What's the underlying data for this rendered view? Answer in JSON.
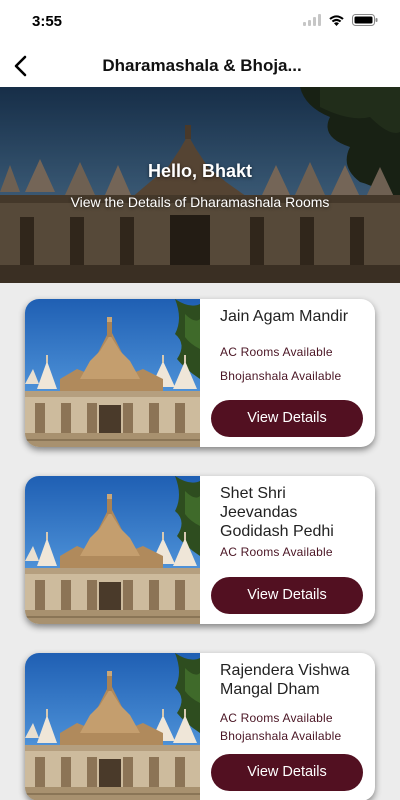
{
  "status_bar": {
    "time": "3:55"
  },
  "header": {
    "title": "Dharamashala & Bhoja...",
    "back_icon": "chevron-left-icon"
  },
  "hero": {
    "title": "Hello, Bhakt",
    "subtitle": "View the Details of Dharamashala Rooms"
  },
  "cards": [
    {
      "name_lines": [
        "Jain Agam Mandir"
      ],
      "features": [
        "AC Rooms Available",
        "Bhojanshala Available"
      ],
      "button_label": "View Details"
    },
    {
      "name_lines": [
        "Shet Shri",
        "Jeevandas",
        "Godidash Pedhi"
      ],
      "features": [
        "AC Rooms Available"
      ],
      "button_label": "View Details"
    },
    {
      "name_lines": [
        "Rajendera Vishwa",
        "Mangal Dham"
      ],
      "features": [
        "AC Rooms Available",
        "Bhojanshala Available"
      ],
      "button_label": "View Details"
    }
  ],
  "colors": {
    "accent": "#521021",
    "feature_text": "#4a1524",
    "background": "#ececec"
  }
}
